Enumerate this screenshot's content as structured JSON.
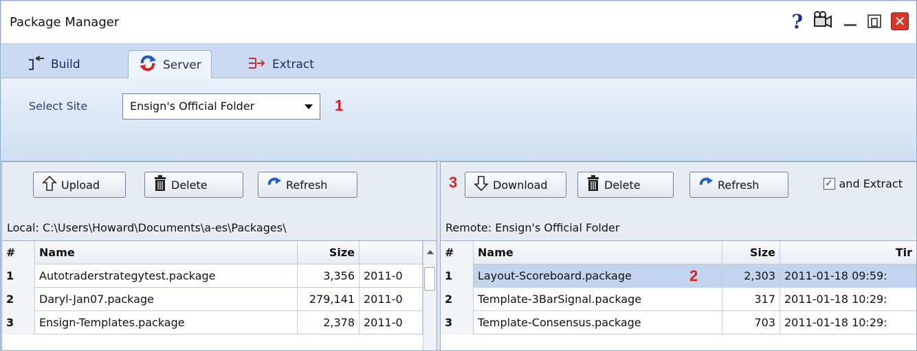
{
  "window": {
    "title": "Package Manager"
  },
  "tabs": [
    {
      "label": "Build",
      "icon": "build-icon"
    },
    {
      "label": "Server",
      "icon": "sync-icon",
      "active": true
    },
    {
      "label": "Extract",
      "icon": "extract-icon"
    }
  ],
  "server": {
    "select_label": "Select Site",
    "selected_site": "Ensign's Official Folder",
    "marker": "1"
  },
  "local": {
    "buttons": {
      "upload": "Upload",
      "delete": "Delete",
      "refresh": "Refresh"
    },
    "path": "Local: C:\\Users\\Howard\\Documents\\a-es\\Packages\\",
    "columns": {
      "num": "#",
      "name": "Name",
      "size": "Size",
      "time": ""
    },
    "rows": [
      {
        "num": "1",
        "name": "Autotraderstrategytest.package",
        "size": "3,356",
        "time": "2011-0"
      },
      {
        "num": "2",
        "name": "Daryl-Jan07.package",
        "size": "279,141",
        "time": "2011-0"
      },
      {
        "num": "3",
        "name": "Ensign-Templates.package",
        "size": "2,378",
        "time": "2011-0"
      }
    ]
  },
  "remote": {
    "marker": "3",
    "buttons": {
      "download": "Download",
      "delete": "Delete",
      "refresh": "Refresh"
    },
    "extract_label": "and Extract",
    "extract_checked": true,
    "path": "Remote: Ensign's Official Folder",
    "columns": {
      "num": "#",
      "name": "Name",
      "size": "Size",
      "time": "Tir"
    },
    "selected_marker": "2",
    "rows": [
      {
        "num": "1",
        "name": "Layout-Scoreboard.package",
        "size": "2,303",
        "time": "2011-01-18 09:59:"
      },
      {
        "num": "2",
        "name": "Template-3BarSignal.package",
        "size": "317",
        "time": "2011-01-18 10:29:"
      },
      {
        "num": "3",
        "name": "Template-Consensus.package",
        "size": "703",
        "time": "2011-01-18 10:29:"
      }
    ]
  },
  "colors": {
    "accent": "#c9daf2",
    "marker": "#e31c1c",
    "selection": "#c3d4ef"
  }
}
